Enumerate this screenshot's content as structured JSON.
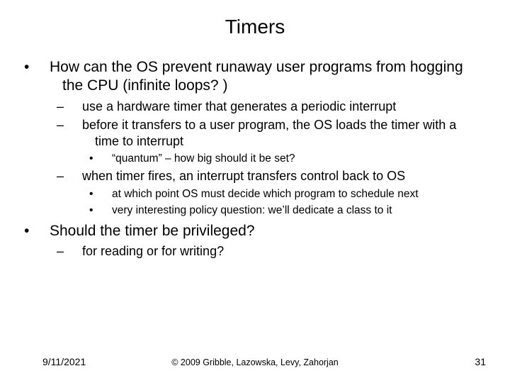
{
  "title": "Timers",
  "bullets": {
    "b1": "How can the OS prevent runaway user programs from hogging the CPU (infinite loops? )",
    "b1a": "use a hardware timer that generates a periodic interrupt",
    "b1b": "before it transfers to a user program, the OS loads the timer with a time to interrupt",
    "b1b1": "“quantum” – how big should it be set?",
    "b1c": "when timer fires, an interrupt transfers control back to OS",
    "b1c1": "at which point OS must decide which program to schedule next",
    "b1c2": "very interesting policy question: we’ll dedicate a class to it",
    "b2": "Should the timer be privileged?",
    "b2a": "for reading or for writing?"
  },
  "footer": {
    "date": "9/11/2021",
    "copyright": "© 2009 Gribble, Lazowska, Levy, Zahorjan",
    "page": "31"
  }
}
